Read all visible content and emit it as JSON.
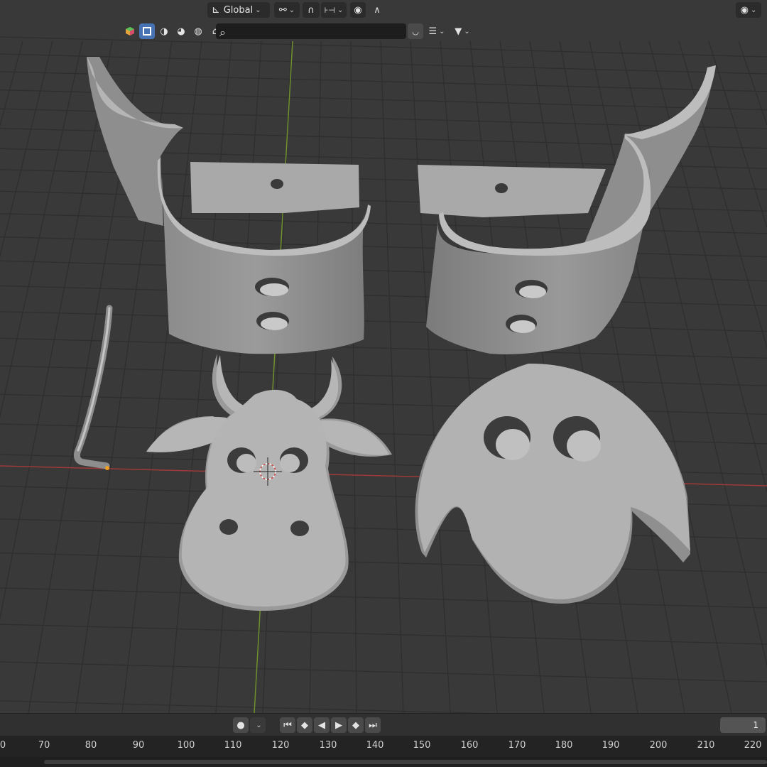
{
  "header": {
    "transform_orientation": "Global",
    "search": {
      "value": "",
      "placeholder": ""
    }
  },
  "icons": {
    "orientation": "orientation-axis-icon",
    "pivot": "pivot-link-icon",
    "snap": "magnet-snap-icon",
    "snap_target": "snap-increment-icon",
    "proportional": "proportional-edit-icon",
    "falloff": "falloff-curve-icon",
    "overlay": "eye-visibility-icon",
    "select_modes": [
      "object-mode-icon",
      "vertex-select-icon",
      "shading-icon",
      "material-icon",
      "render-icon",
      "paint-icon"
    ],
    "filter": "filter-icon",
    "view_type": "outliner-view-icon"
  },
  "colors": {
    "viewport_bg": "#393939",
    "grid_line": "#2f2f2f",
    "x_axis": "#b43a3a",
    "y_axis": "#6a8f2a",
    "active_blue": "#4772b3",
    "model_gray": "#a9a9a9"
  },
  "timeline": {
    "current_frame": "1",
    "ticks": [
      "0",
      "70",
      "80",
      "90",
      "100",
      "110",
      "120",
      "130",
      "140",
      "150",
      "160",
      "170",
      "180",
      "190",
      "200",
      "210",
      "220"
    ]
  }
}
